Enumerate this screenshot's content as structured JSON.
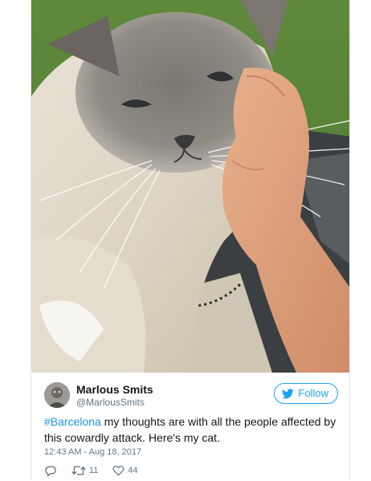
{
  "tweet": {
    "display_name": "Marlous Smits",
    "screen_name": "@MarlousSmits",
    "follow_label": "Follow",
    "text_hashtag": "#Barcelona",
    "text_body": " my thoughts are with all the people affected by this cowardly attack. Here's my cat.",
    "timestamp": "12:43 AM - Aug 18, 2017",
    "retweet_count": "11",
    "like_count": "44"
  },
  "icons": {
    "reply": "reply-icon",
    "retweet": "retweet-icon",
    "like": "heart-icon",
    "follow": "twitter-bird-icon"
  },
  "colors": {
    "accent": "#1da1f2",
    "hashtag": "#1b95e0",
    "text": "#14171a",
    "muted": "#657786"
  }
}
